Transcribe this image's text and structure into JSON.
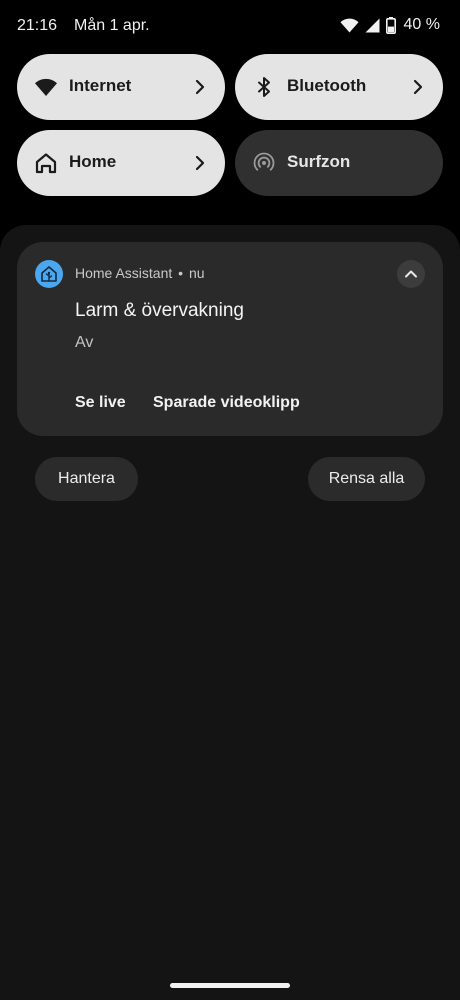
{
  "status_bar": {
    "time": "21:16",
    "date": "Mån 1 apr.",
    "battery": "40 %",
    "icons": [
      "wifi-icon",
      "cellular-signal-icon",
      "battery-icon"
    ]
  },
  "quick_settings": {
    "tiles": [
      {
        "label": "Internet",
        "icon": "wifi-icon",
        "active": true
      },
      {
        "label": "Bluetooth",
        "icon": "bluetooth-icon",
        "active": true
      },
      {
        "label": "Home",
        "icon": "home-icon",
        "active": true
      },
      {
        "label": "Surfzon",
        "icon": "hotspot-icon",
        "active": false
      }
    ]
  },
  "notification": {
    "app_name": "Home Assistant",
    "separator": "•",
    "time": "nu",
    "title": "Larm & övervakning",
    "text": "Av",
    "actions": [
      {
        "label": "Se live"
      },
      {
        "label": "Sparade videoklipp"
      }
    ]
  },
  "shade_actions": {
    "manage": "Hantera",
    "clear_all": "Rensa alla"
  },
  "colors": {
    "background": "#000000",
    "shade": "#141414",
    "card": "#2a2a2a",
    "tile_active": "#e4e4e4",
    "tile_inactive": "#303030",
    "app_icon": "#4aa7f0"
  }
}
